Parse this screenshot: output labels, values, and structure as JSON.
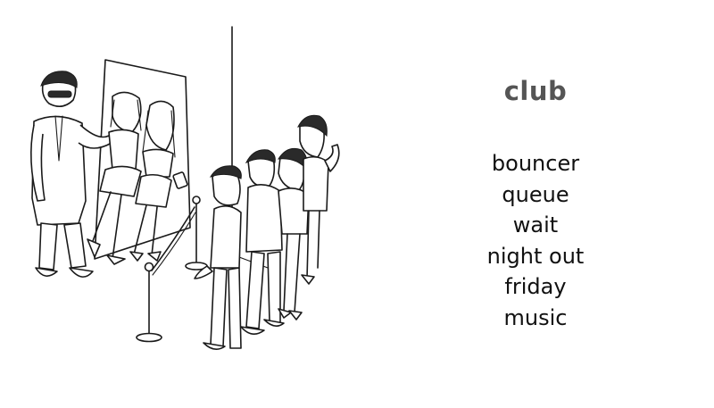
{
  "illustration": {
    "subject": "club-queue-drawing"
  },
  "vocab": {
    "title": "club",
    "words": [
      "bouncer",
      "queue",
      "wait",
      "night out",
      "friday",
      "music"
    ]
  },
  "colors": {
    "title": "#555555",
    "text": "#111111",
    "ink": "#1a1a1a",
    "background": "#ffffff"
  }
}
